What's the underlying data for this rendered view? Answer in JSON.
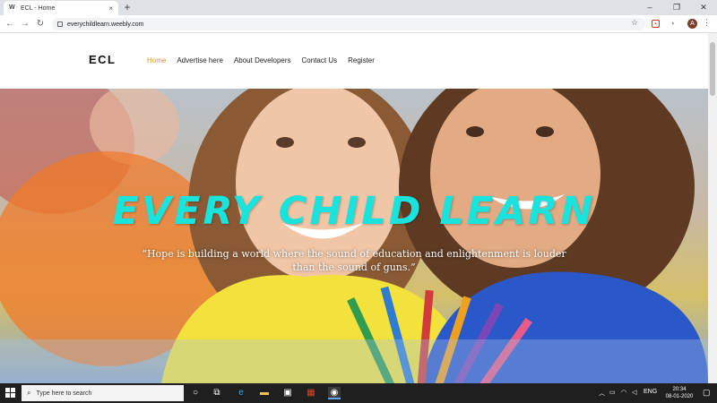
{
  "browser": {
    "tab_title": "ECL - Home",
    "tab_favicon": "W",
    "tab_close": "×",
    "new_tab": "+",
    "url": "everychildlearn.weebly.com",
    "profile_initial": "A",
    "min_glyph": "–",
    "max_glyph": "❐",
    "close_glyph": "✕"
  },
  "site": {
    "logo": "ECL",
    "nav": [
      "Home",
      "Advertise here",
      "About Developers",
      "Contact Us",
      "Register"
    ],
    "hero_title": "EVERY CHILD LEARN",
    "hero_quote": "“Hope is building a world where the sound of education and enlightenment is louder than the sound of guns.”"
  },
  "taskbar": {
    "search_placeholder": "Type here to search",
    "language": "ENG",
    "time": "20:34",
    "date": "08-01-2020"
  },
  "colors": {
    "accent_nav_active": "#d19a1b",
    "hero_title": "#18e3dc"
  }
}
